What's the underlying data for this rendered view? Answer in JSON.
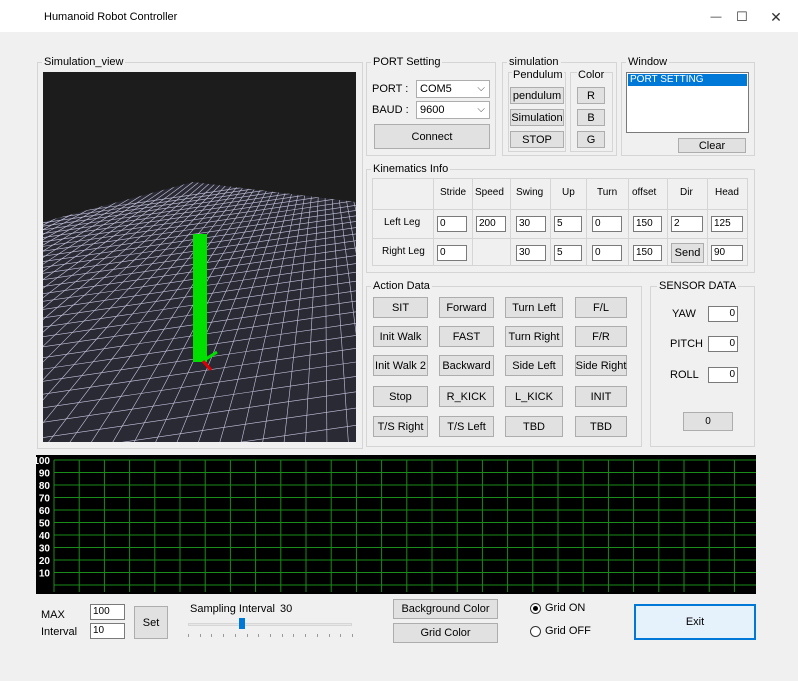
{
  "window": {
    "title": "Humanoid Robot Controller",
    "minimize_glyph": "—",
    "maximize_glyph": "☐",
    "close_glyph": "✕"
  },
  "simulation_view": {
    "label": "Simulation_view"
  },
  "port_setting": {
    "label": "PORT Setting",
    "port_label": "PORT :",
    "port_value": "COM5",
    "baud_label": "BAUD :",
    "baud_value": "9600",
    "connect_label": "Connect"
  },
  "simulation": {
    "label": "simulation",
    "pendulum_header": "Pendulum",
    "pendulum_button": "pendulum",
    "simulation_button": "Simulation",
    "stop_button": "STOP",
    "color_header": "Color",
    "color_r": "R",
    "color_b": "B",
    "color_g": "G"
  },
  "window_panel": {
    "label": "Window",
    "selected_item": "PORT SETTING",
    "clear_label": "Clear"
  },
  "kinematics": {
    "label": "Kinematics Info",
    "columns": [
      "Stride",
      "Speed",
      "Swing",
      "Up",
      "Turn",
      "offset",
      "Dir",
      "Head"
    ],
    "left_label": "Left Leg",
    "left_values": {
      "stride": "0",
      "speed": "200",
      "swing": "30",
      "up": "5",
      "turn": "0",
      "offset": "150",
      "dir": "2",
      "head": "125"
    },
    "right_label": "Right Leg",
    "right_values": {
      "stride": "0",
      "swing": "30",
      "up": "5",
      "turn": "0",
      "offset": "150",
      "head": "90"
    },
    "send_label": "Send"
  },
  "action_data": {
    "label": "Action Data",
    "buttons": [
      [
        "SIT",
        "Forward",
        "Turn Left",
        "F/L"
      ],
      [
        "Init Walk",
        "FAST",
        "Turn Right",
        "F/R"
      ],
      [
        "Init Walk 2",
        "Backward",
        "Side Left",
        "Side Right"
      ],
      [
        "Stop",
        "R_KICK",
        "L_KICK",
        "INIT"
      ],
      [
        "T/S Right",
        "T/S Left",
        "TBD",
        "TBD"
      ]
    ]
  },
  "sensor_data": {
    "label": "SENSOR DATA",
    "yaw_label": "YAW",
    "yaw_value": "0",
    "pitch_label": "PITCH",
    "pitch_value": "0",
    "roll_label": "ROLL",
    "roll_value": "0",
    "extra_value": "0"
  },
  "graph": {
    "y_ticks": [
      "100",
      "90",
      "80",
      "70",
      "60",
      "50",
      "40",
      "30",
      "20",
      "10"
    ],
    "grid_color": "#1a8c1a"
  },
  "bottom": {
    "max_label": "MAX",
    "max_value": "100",
    "interval_label": "Interval",
    "interval_value": "10",
    "set_label": "Set",
    "sampling_label": "Sampling Interval",
    "sampling_value": "30",
    "slider_fraction": 0.33,
    "background_color_label": "Background Color",
    "grid_color_label": "Grid Color",
    "grid_on_label": "Grid ON",
    "grid_off_label": "Grid OFF",
    "grid_on_selected": true,
    "exit_label": "Exit"
  },
  "colors": {
    "robot_body": "#00e000",
    "axis_red": "#e00000",
    "selection": "#0078d7",
    "exit_border": "#0078d7"
  }
}
